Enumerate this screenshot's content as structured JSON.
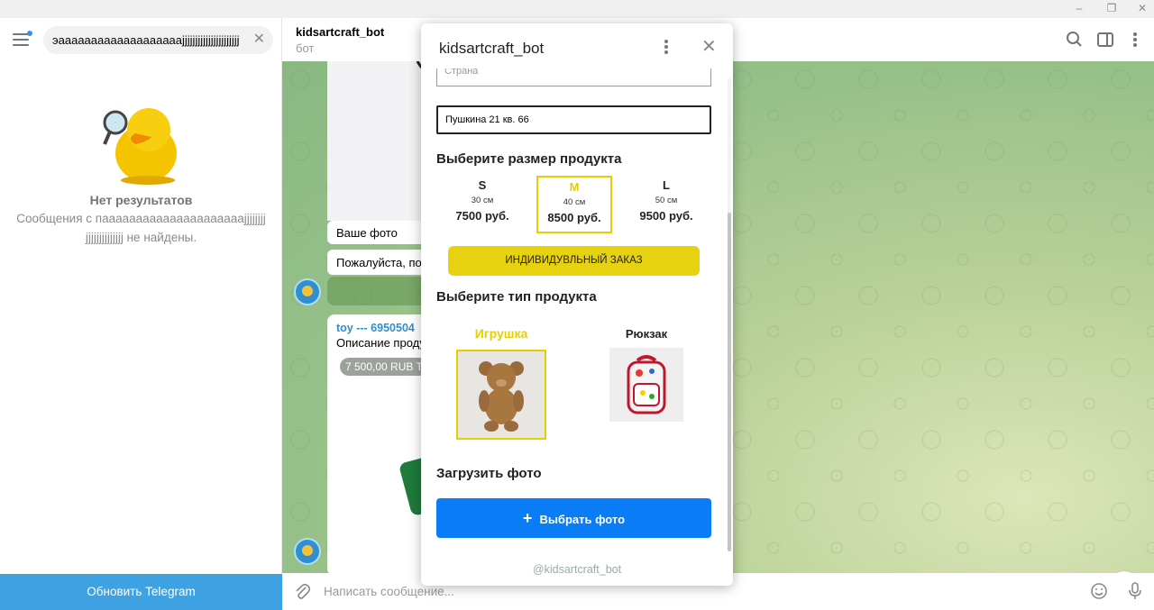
{
  "sidebar": {
    "search_value": "эaaaaaaaaaaaaaaaaaaajjjjjjjjjjjjjjjjjjjjjj",
    "empty_title": "Нет результатов",
    "empty_subtitle": "Сообщения с пaaaaaaaaaaaaaaaaaaaaajjjjjjjjjjjjjjjjjjjjjj не найдены.",
    "update_button": "Обновить Telegram"
  },
  "chat": {
    "title": "kidsartcraft_bot",
    "subtitle": "бот",
    "messages": {
      "photo_caption": "Ваше фото",
      "prompt": "Пожалуйста, под",
      "product_name": "toy --- 6950504",
      "product_desc": "Описание проду",
      "product_price": "7 500,00 RUB T"
    },
    "composer_placeholder": "Написать сообщение..."
  },
  "popup": {
    "title": "kidsartcraft_bot",
    "field_top_placeholder": "Страна",
    "address_value": "Пушкина 21 кв. 66",
    "size_section": "Выберите размер продукта",
    "sizes": [
      {
        "letter": "S",
        "cm": "30 см",
        "price": "7500 руб."
      },
      {
        "letter": "M",
        "cm": "40 см",
        "price": "8500 руб."
      },
      {
        "letter": "L",
        "cm": "50 см",
        "price": "9500 руб."
      }
    ],
    "selected_size": "M",
    "custom_order": "ИНДИВИДУВЛЬНЫЙ ЗАКАЗ",
    "type_section": "Выберите тип продукта",
    "types": [
      {
        "label": "Игрушка"
      },
      {
        "label": "Рюкзак"
      }
    ],
    "selected_type": "Игрушка",
    "upload_section": "Загрузить фото",
    "upload_button_icon": "+",
    "upload_button": "Выбрать фото",
    "footer": "@kidsartcraft_bot"
  },
  "colors": {
    "accent_yellow": "#e5cf00",
    "button_blue": "#0a7cf5",
    "update_blue": "#3ea2e2"
  }
}
